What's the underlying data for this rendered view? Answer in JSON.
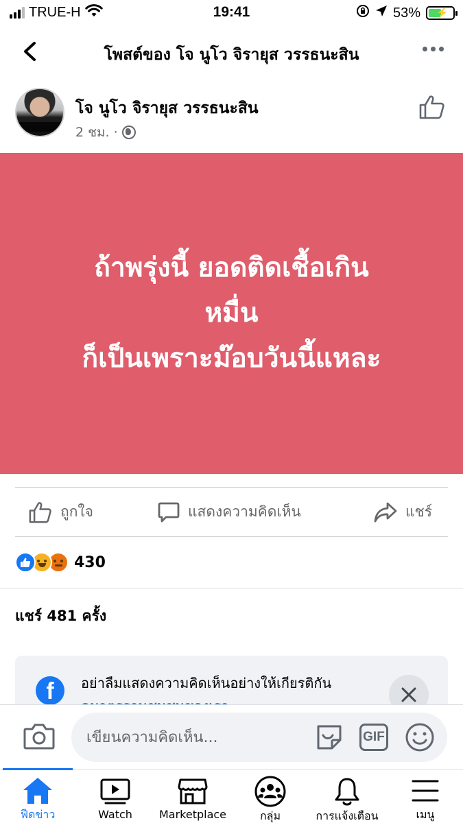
{
  "status_bar": {
    "carrier": "TRUE-H",
    "time": "19:41",
    "battery": "53%",
    "battery_level": 0.53
  },
  "header": {
    "title": "โพสต์ของ โจ นูโว จิรายุส วรรธนะสิน"
  },
  "post": {
    "author": "โจ นูโว จิรายุส วรรธนะสิน",
    "time": "2 ชม.",
    "separator": "·",
    "privacy_icon": "globe-icon",
    "background_color": "#e05d6c",
    "text": "ถ้าพรุ่งนี้ ยอดติดเชื้อเกิน\nหมื่น\nก็เป็นเพราะม๊อบวันนี้แหละ"
  },
  "actions": {
    "like_label": "ถูกใจ",
    "comment_label": "แสดงความคิดเห็น",
    "share_label": "แชร์"
  },
  "reactions": {
    "types": [
      "like",
      "haha",
      "angry"
    ],
    "count": "430"
  },
  "shares": {
    "text": "แชร์ 481 ครั้ง"
  },
  "notice": {
    "text": "อย่าลืมแสดงความคิดเห็นอย่างให้เกียรติกัน",
    "link": "ดมาตรฐานชุมชนของเรา"
  },
  "composer": {
    "placeholder": "เขียนความคิดเห็น...",
    "gif_label": "GIF"
  },
  "tabbar": {
    "tabs": [
      {
        "label": "ฟีดข่าว",
        "icon": "home-icon",
        "active": true
      },
      {
        "label": "Watch",
        "icon": "watch-icon",
        "active": false
      },
      {
        "label": "Marketplace",
        "icon": "marketplace-icon",
        "active": false
      },
      {
        "label": "กลุ่ม",
        "icon": "groups-icon",
        "active": false
      },
      {
        "label": "การแจ้งเตือน",
        "icon": "bell-icon",
        "active": false
      },
      {
        "label": "เมนู",
        "icon": "menu-icon",
        "active": false
      }
    ]
  },
  "colors": {
    "accent": "#1877f2",
    "post_background": "#e05d6c",
    "secondary_text": "#65676b"
  }
}
